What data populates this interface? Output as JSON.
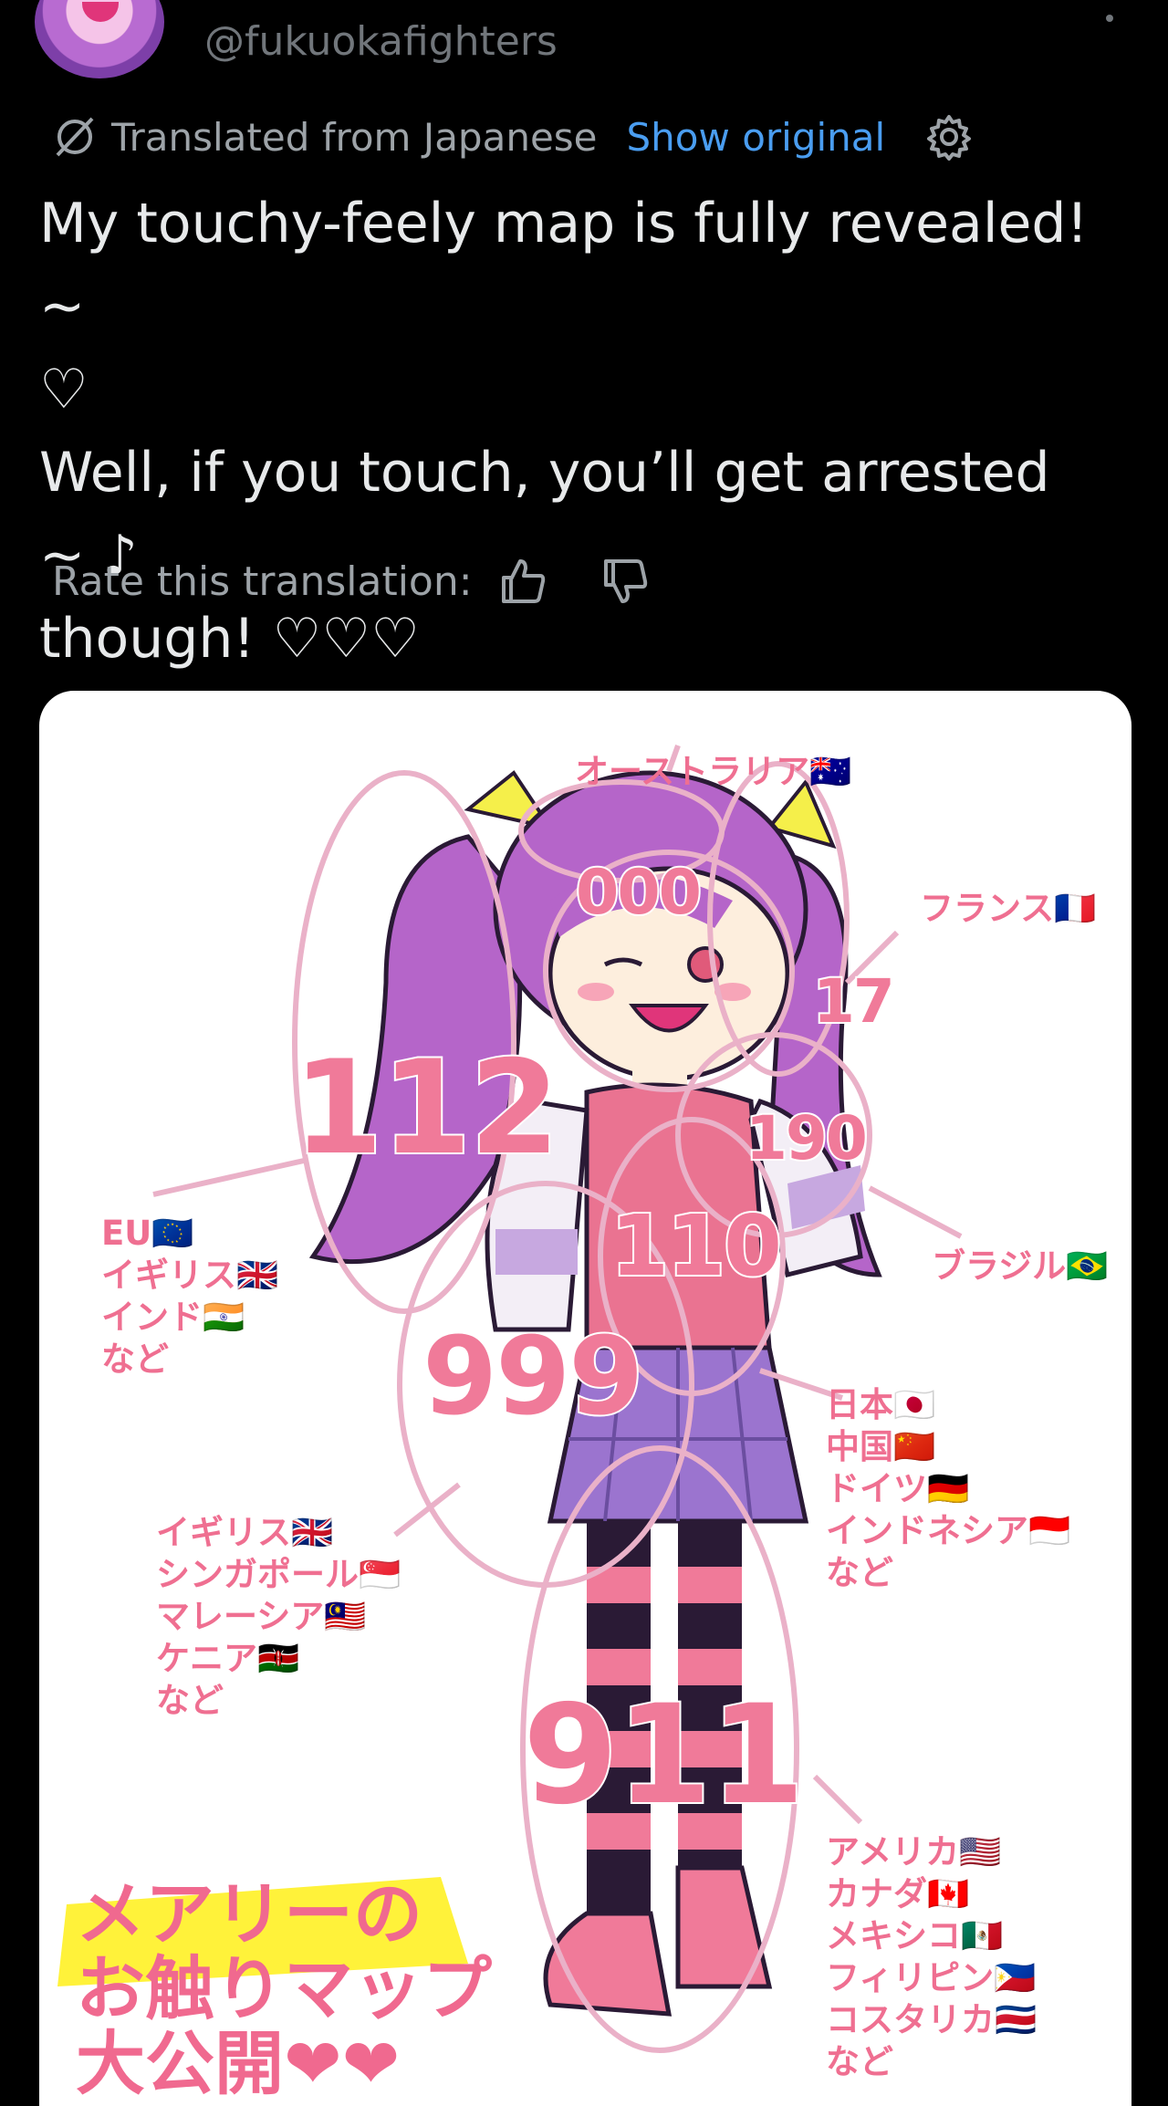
{
  "header": {
    "handle": "@fukuokafighters"
  },
  "translation_bar": {
    "label": "Translated from Japanese",
    "show_original": "Show original"
  },
  "tweet": {
    "text": "My touchy-feely map is fully revealed!  ~\n♡\nWell, if you touch, you’ll get arrested ~ ♪\nthough! ♡♡♡"
  },
  "rate": {
    "label": "Rate this translation:"
  },
  "image": {
    "numbers": {
      "n000": "000",
      "n17": "17",
      "n112": "112",
      "n190": "190",
      "n110": "110",
      "n999": "999",
      "n911": "911"
    },
    "labels": {
      "australia": "オーストラリア🇦🇺",
      "france": "フランス🇫🇷",
      "eu_group": "EU🇪🇺\nイギリス🇬🇧\nインド🇮🇳\nなど",
      "brazil": "ブラジル🇧🇷",
      "group_110": "日本🇯🇵\n中国🇨🇳\nドイツ🇩🇪\nインドネシア🇮🇩\nなど",
      "group_999": "イギリス🇬🇧\nシンガポール🇸🇬\nマレーシア🇲🇾\nケニア🇰🇪\nなど",
      "group_911": "アメリカ🇺🇸\nカナダ🇨🇦\nメキシコ🇲🇽\nフィリピン🇵🇭\nコスタリカ🇨🇷\nなど"
    },
    "title": {
      "line1": "メアリーの",
      "line2": "お触りマップ",
      "line3": "大公開❤❤"
    }
  },
  "colors": {
    "link": "#4a9df0",
    "muted": "#71767b",
    "accent_pink": "#ef6f91",
    "highlight_yellow": "#fff23a"
  }
}
